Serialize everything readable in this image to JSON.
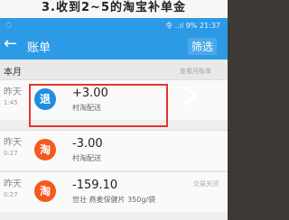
{
  "caption": "3.收到2~5的淘宝补单金",
  "status_bar": {
    "info": "令 ..ıl 9% 21:37"
  },
  "header": {
    "back_icon": "back-arrow-icon",
    "title": "账单",
    "filter_label": "筛选"
  },
  "section": {
    "month_label": "本月",
    "link_text": "查看月账单"
  },
  "transactions": [
    {
      "date": "昨天",
      "time": "1:45",
      "icon": "退",
      "amount": "+3.00",
      "description": "村淘配送",
      "status": ""
    },
    {
      "date": "昨天",
      "time": "0:27",
      "icon": "淘",
      "amount": "-3.00",
      "description": "村淘配送",
      "status": ""
    },
    {
      "date": "昨天",
      "time": "0:27",
      "icon": "淘",
      "amount": "-159.10",
      "description": "世壮 燕麦保健片 350g/袋",
      "status": "交易关闭"
    }
  ],
  "colors": {
    "accent": "#2d9ae6",
    "refund_badge": "#1e8fe0",
    "taobao_badge": "#f25a1f",
    "highlight": "#e4352a"
  }
}
